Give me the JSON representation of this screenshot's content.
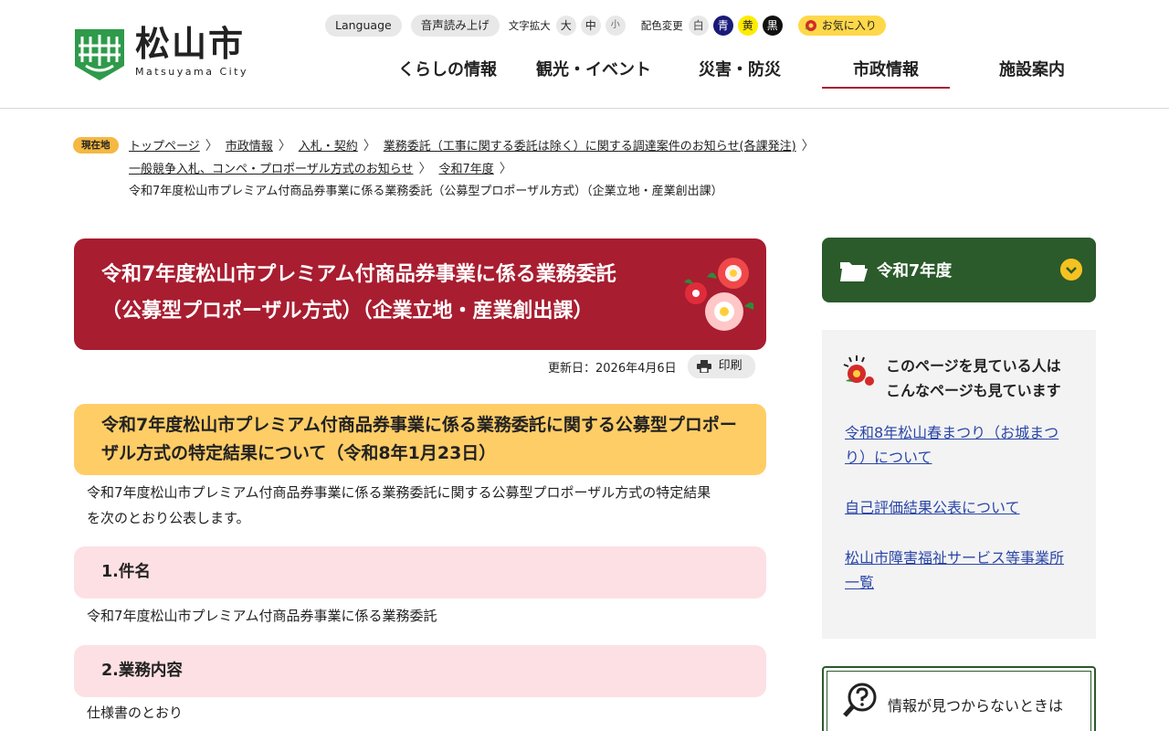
{
  "header": {
    "logo_name": "松山市",
    "logo_sub": "Matsuyama City",
    "util": {
      "language": "Language",
      "read_aloud": "音声読み上げ",
      "text_size_label": "文字拡大",
      "size_large": "大",
      "size_medium": "中",
      "size_small": "小",
      "color_label": "配色変更",
      "color_white": "白",
      "color_blue": "青",
      "color_yellow": "黄",
      "color_black": "黒",
      "favorite": "お気に入り"
    },
    "nav": [
      "くらしの情報",
      "観光・イベント",
      "災害・防災",
      "市政情報",
      "施設案内"
    ]
  },
  "breadcrumb": {
    "badge": "現在地",
    "links": [
      "トップページ",
      "市政情報",
      "入札・契約",
      "業務委託（工事に関する委託は除く）に関する調達案件のお知らせ(各課発注)",
      "一般競争入札、コンペ・プロポーザル方式のお知らせ",
      "令和7年度"
    ],
    "current": "令和7年度松山市プレミアム付商品券事業に係る業務委託（公募型プロポーザル方式）（企業立地・産業創出課）"
  },
  "main": {
    "title_line1": "令和7年度松山市プレミアム付商品券事業に係る業務委託",
    "title_line2": "（公募型プロポーザル方式）（企業立地・産業創出課）",
    "updated": "更新日：2026年4月6日",
    "print": "印刷",
    "h2": "令和7年度松山市プレミアム付商品券事業に係る業務委託に関する公募型プロポーザル方式の特定結果について（令和8年1月23日）",
    "intro_line1": "令和7年度松山市プレミアム付商品券事業に係る業務委託に関する公募型プロポーザル方式の特定結果",
    "intro_line2": "を次のとおり公表します。",
    "section1_heading": "1.件名",
    "section1_body": "令和7年度松山市プレミアム付商品券事業に係る業務委託",
    "section2_heading": "2.業務内容",
    "section2_body": "仕様書のとおり"
  },
  "sidebar": {
    "nav_label": "令和7年度",
    "rec_title_line1": "このページを見ている人は",
    "rec_title_line2": "こんなページも見ています",
    "rec_links": [
      {
        "line1": "令和8年松山春まつり（お城まつ",
        "line2": "り）について"
      },
      {
        "line1": "自己評価結果公表について",
        "line2": ""
      },
      {
        "line1": "松山市障害福祉サービス等事業所",
        "line2": "一覧"
      }
    ],
    "notfound": "情報が見つからないときは"
  },
  "colors": {
    "brand_red": "#a81d30",
    "brand_green": "#2b5a2b",
    "accent_yellow": "#ffcd66",
    "pink": "#fde0e3",
    "link_blue": "#2a46a8"
  },
  "icons": [
    "matsuyama-logo-icon",
    "favorite-icon",
    "camellia-decoration-icon",
    "printer-icon",
    "folder-icon",
    "chevron-down-icon",
    "recommend-icon",
    "question-search-icon"
  ]
}
